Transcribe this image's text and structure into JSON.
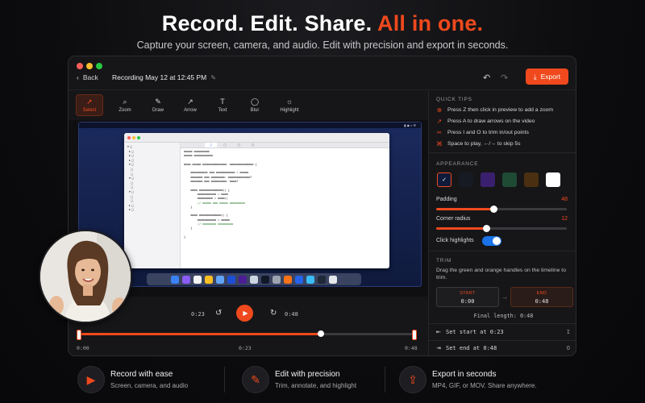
{
  "hero": {
    "headline_main": "Record. Edit. Share.",
    "headline_accent": "All in one.",
    "subheadline": "Capture your screen, camera, and audio. Edit with precision and export in seconds."
  },
  "titlebar": {
    "back_label": "Back",
    "recording_title": "Recording May 12 at 12:45 PM",
    "export_label": "Export"
  },
  "tools": [
    {
      "label": "Select",
      "icon": "cursor-icon",
      "active": true
    },
    {
      "label": "Zoom",
      "icon": "magnifier-icon",
      "active": false
    },
    {
      "label": "Draw",
      "icon": "pen-icon",
      "active": false
    },
    {
      "label": "Arrow",
      "icon": "arrow-icon",
      "active": false
    },
    {
      "label": "Text",
      "icon": "text-icon",
      "active": false
    },
    {
      "label": "Blur",
      "icon": "blur-icon",
      "active": false
    },
    {
      "label": "Highlight",
      "icon": "highlight-icon",
      "active": false
    }
  ],
  "playback": {
    "current_time": "0:23",
    "end_time": "0:48",
    "timeline_start": "0:00",
    "timeline_mid": "0:23",
    "timeline_end": "0:48",
    "progress": 0.72
  },
  "quick_tips": {
    "header": "QUICK TIPS",
    "items": [
      {
        "icon": "zoom-icon",
        "text": "Press Z then click in preview to add a zoom"
      },
      {
        "icon": "arrow-icon",
        "text": "Press A to draw arrows on the video"
      },
      {
        "icon": "scissors-icon",
        "text": "Press I and O to trim in/out points"
      },
      {
        "icon": "command-icon",
        "text": "Space to play, ←/→ to skip 5s"
      }
    ]
  },
  "appearance": {
    "header": "APPEARANCE",
    "swatches": [
      "#101a3a",
      "#161a22",
      "#3a1f6e",
      "#1f4a34",
      "#4a3010",
      "#ffffff"
    ],
    "selected_swatch": 0,
    "padding_label": "Padding",
    "padding_value": "48",
    "padding_fraction": 0.44,
    "radius_label": "Corner radius",
    "radius_value": "12",
    "radius_fraction": 0.38,
    "click_highlights_label": "Click highlights",
    "click_highlights_on": true
  },
  "trim": {
    "header": "TRIM",
    "description": "Drag the green and orange handles on the timeline to trim.",
    "start_label": "START",
    "start_value": "0:00",
    "end_label": "END",
    "end_value": "0:48",
    "final_length": "Final length: 0:48",
    "set_start": "Set start at 0:23",
    "set_start_key": "I",
    "set_end": "Set end at 0:48",
    "set_end_key": "O"
  },
  "features": [
    {
      "icon": "camera-icon",
      "title": "Record with ease",
      "desc": "Screen, camera, and audio"
    },
    {
      "icon": "pencil-icon",
      "title": "Edit with precision",
      "desc": "Trim, annotate, and highlight"
    },
    {
      "icon": "share-icon",
      "title": "Export in seconds",
      "desc": "MP4, GIF, or MOV. Share anywhere."
    }
  ],
  "colors": {
    "accent": "#f0491d",
    "toggle": "#1a73e8",
    "background": "#0c0c0e",
    "panel": "#161618"
  }
}
